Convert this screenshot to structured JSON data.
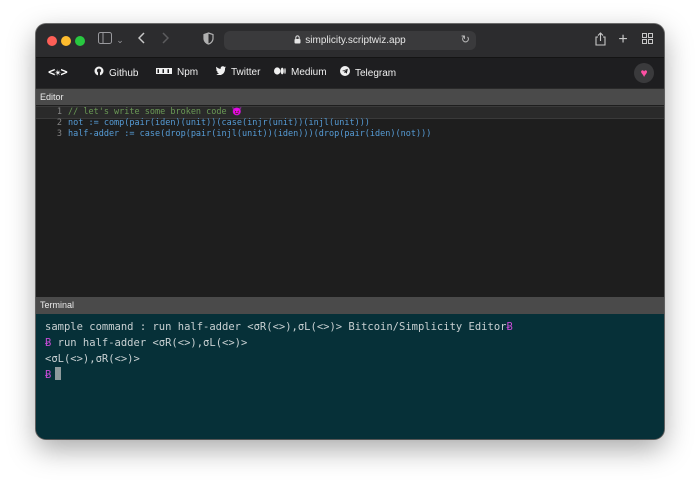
{
  "browser": {
    "url": "simplicity.scriptwiz.app",
    "icons": [
      "sidebar-icon",
      "chevron-down-icon",
      "back-icon",
      "forward-icon",
      "shield-icon",
      "lock-icon",
      "reload-icon",
      "share-icon",
      "new-tab-icon",
      "tab-overview-icon"
    ]
  },
  "site_nav": {
    "logo": "<✴>",
    "links": [
      {
        "label": "Github",
        "icon": "github-icon"
      },
      {
        "label": "Npm",
        "icon": "npm-icon"
      },
      {
        "label": "Twitter",
        "icon": "twitter-icon"
      },
      {
        "label": "Medium",
        "icon": "medium-icon"
      },
      {
        "label": "Telegram",
        "icon": "telegram-icon"
      }
    ],
    "heart_icon": "heart-icon"
  },
  "editor": {
    "header": "Editor",
    "lines": [
      {
        "num": "1",
        "text": "// let's write some broken code 😈"
      },
      {
        "num": "2",
        "text": "not := comp(pair(iden)(unit))(case(injr(unit))(injl(unit)))"
      },
      {
        "num": "3",
        "text": "half-adder := case(drop(pair(injl(unit))(iden)))(drop(pair(iden)(not)))"
      }
    ]
  },
  "terminal": {
    "header": "Terminal",
    "lines": [
      {
        "prefix": "",
        "text": "sample command : run half-adder <σR(<>),σL(<>)> Bitcoin/Simplicity Editor",
        "suffix": "Ƀ"
      },
      {
        "prefix": "Ƀ",
        "text": " run half-adder <σR(<>),σL(<>)>",
        "suffix": ""
      },
      {
        "prefix": "",
        "text": "<σL(<>),σR(<>)>",
        "suffix": ""
      },
      {
        "prefix": "Ƀ",
        "text": "",
        "suffix": ""
      }
    ]
  },
  "colors": {
    "editor_bg": "#1e1e1e",
    "terminal_bg": "#063038",
    "prompt_symbol": "#c74bd6",
    "heart": "#ff4fa3"
  }
}
